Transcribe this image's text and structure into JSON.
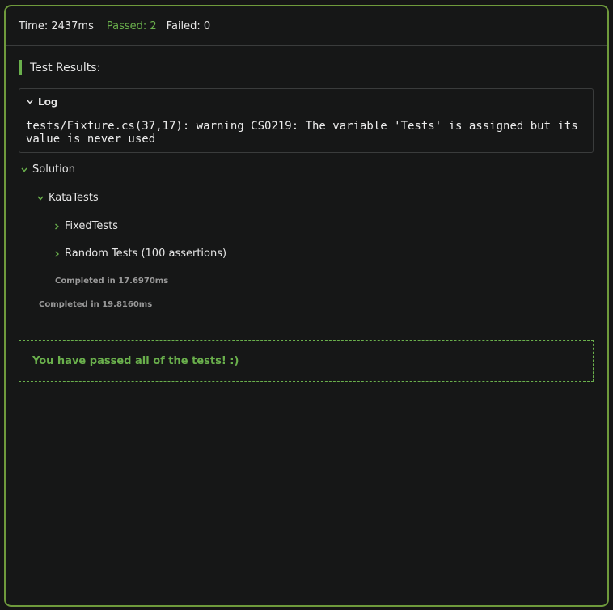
{
  "header": {
    "time": "Time: 2437ms",
    "passed": "Passed: 2",
    "failed": "Failed: 0"
  },
  "results": {
    "title": "Test Results:"
  },
  "log": {
    "label": "Log",
    "text": "tests/Fixture.cs(37,17): warning CS0219: The variable 'Tests' is assigned but its value is never used"
  },
  "tree": {
    "solution": "Solution",
    "kata_tests": "KataTests",
    "fixed_tests": "FixedTests",
    "random_tests": "Random Tests (100 assertions)",
    "kata_completed": "Completed in 17.6970ms",
    "solution_completed": "Completed in 19.8160ms"
  },
  "summary": {
    "message": "You have passed all of the tests! :)"
  },
  "colors": {
    "accent_green": "#6ab04c",
    "frame_border": "#6f9a3c",
    "background": "#161717"
  },
  "icons": {
    "expanded": "chevron-down-icon",
    "collapsed": "chevron-right-icon"
  }
}
